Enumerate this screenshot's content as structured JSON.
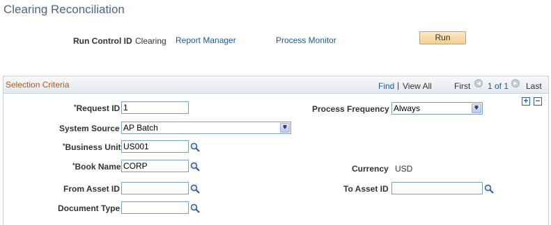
{
  "page": {
    "title": "Clearing Reconciliation"
  },
  "run_control": {
    "label": "Run Control ID",
    "value": "Clearing",
    "report_manager": "Report Manager",
    "process_monitor": "Process Monitor",
    "run_button": "Run"
  },
  "panel": {
    "title": "Selection Criteria",
    "find": "Find",
    "separator": "|",
    "view_all": "View All",
    "first": "First",
    "pager": "1 of 1",
    "last": "Last",
    "add": "+",
    "remove": "−"
  },
  "fields": {
    "request_id": {
      "label": "Request ID",
      "required_mark": "*",
      "value": "1"
    },
    "process_frequency": {
      "label": "Process Frequency",
      "value": "Always"
    },
    "system_source": {
      "label": "System Source",
      "value": "AP Batch"
    },
    "business_unit": {
      "label": "Business Unit",
      "required_mark": "*",
      "value": "US001"
    },
    "book_name": {
      "label": "Book Name",
      "required_mark": "*",
      "value": "CORP"
    },
    "currency": {
      "label": "Currency",
      "value": "USD"
    },
    "from_asset_id": {
      "label": "From Asset ID",
      "value": ""
    },
    "to_asset_id": {
      "label": "To Asset ID",
      "value": ""
    },
    "document_type": {
      "label": "Document Type",
      "value": ""
    }
  },
  "colors": {
    "title": "#4f6480",
    "link": "#1a5a96",
    "panel_title": "#b05a1a",
    "run_button": "#f5cf8f"
  }
}
